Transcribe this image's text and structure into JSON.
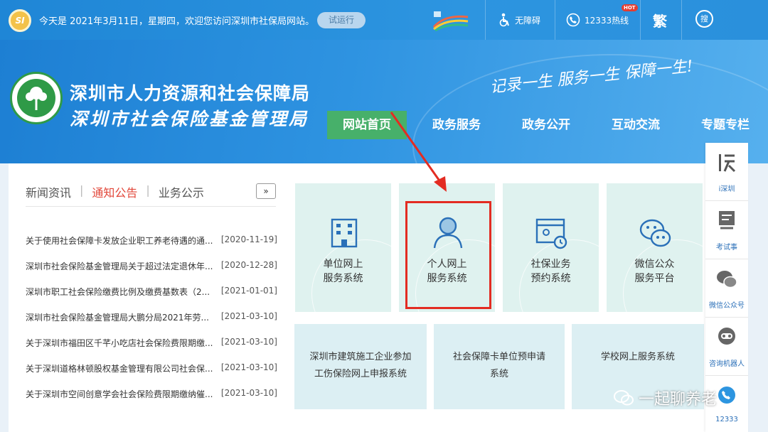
{
  "topbar": {
    "logo_text": "SI",
    "welcome": "今天是 2021年3月11日，星期四，欢迎您访问深圳市社保局网站。",
    "trial_label": "试运行",
    "accessibility_label": "无障碍",
    "hotline_label": "12333热线",
    "hot_badge": "HOT",
    "traditional_label": "繁",
    "search_label": "搜"
  },
  "header": {
    "org_name_1": "深圳市人力资源和社会保障局",
    "org_name_2": "深圳市社会保险基金管理局",
    "slogan": "记录一生 服务一生 保障一生!",
    "nav": [
      {
        "label": "网站首页",
        "active": true
      },
      {
        "label": "政务服务",
        "active": false
      },
      {
        "label": "政务公开",
        "active": false
      },
      {
        "label": "互动交流",
        "active": false
      },
      {
        "label": "专题专栏",
        "active": false
      }
    ]
  },
  "news": {
    "tabs": [
      "新闻资讯",
      "通知公告",
      "业务公示"
    ],
    "active_tab": "通知公告",
    "more_label": "»",
    "items": [
      {
        "title": "关于使用社会保障卡发放企业职工养老待遇的通...",
        "date": "[2020-11-19]"
      },
      {
        "title": "深圳市社会保险基金管理局关于超过法定退休年...",
        "date": "[2020-12-28]"
      },
      {
        "title": "深圳市职工社会保险缴费比例及缴费基数表（2...",
        "date": "[2021-01-01]"
      },
      {
        "title": "深圳市社会保险基金管理局大鹏分局2021年劳...",
        "date": "[2021-03-10]"
      },
      {
        "title": "关于深圳市福田区千芊小吃店社会保险费限期缴...",
        "date": "[2021-03-10]"
      },
      {
        "title": "关于深圳道格林顿股权基金管理有限公司社会保...",
        "date": "[2021-03-10]"
      },
      {
        "title": "关于深圳市空间创意学会社会保险费限期缴纳催...",
        "date": "[2021-03-10]"
      }
    ]
  },
  "services": [
    {
      "line1": "单位网上",
      "line2": "服务系统",
      "icon": "building-icon"
    },
    {
      "line1": "个人网上",
      "line2": "服务系统",
      "icon": "person-icon"
    },
    {
      "line1": "社保业务",
      "line2": "预约系统",
      "icon": "calendar-clock-icon"
    },
    {
      "line1": "微信公众",
      "line2": "服务平台",
      "icon": "wechat-icon"
    }
  ],
  "wide_services": [
    {
      "line1": "深圳市建筑施工企业参加",
      "line2": "工伤保险网上申报系统"
    },
    {
      "line1": "社会保障卡单位预申请",
      "line2": "系统"
    },
    {
      "line1": "学校网上服务系统",
      "line2": ""
    }
  ],
  "sidebar": [
    {
      "label": "i深圳",
      "icon": "i-shenzhen-icon"
    },
    {
      "label": "考试事",
      "icon": "exam-icon"
    },
    {
      "label": "微信公众号",
      "icon": "wechat-icon"
    },
    {
      "label": "咨询机器人",
      "icon": "robot-icon"
    },
    {
      "label": "12333",
      "icon": "hotline-icon"
    }
  ],
  "watermark": "一起聊养老",
  "colors": {
    "accent_blue": "#2d95e0",
    "nav_active": "#47b06a",
    "highlight_red": "#e32c22",
    "card_bg": "#dff2ef"
  }
}
